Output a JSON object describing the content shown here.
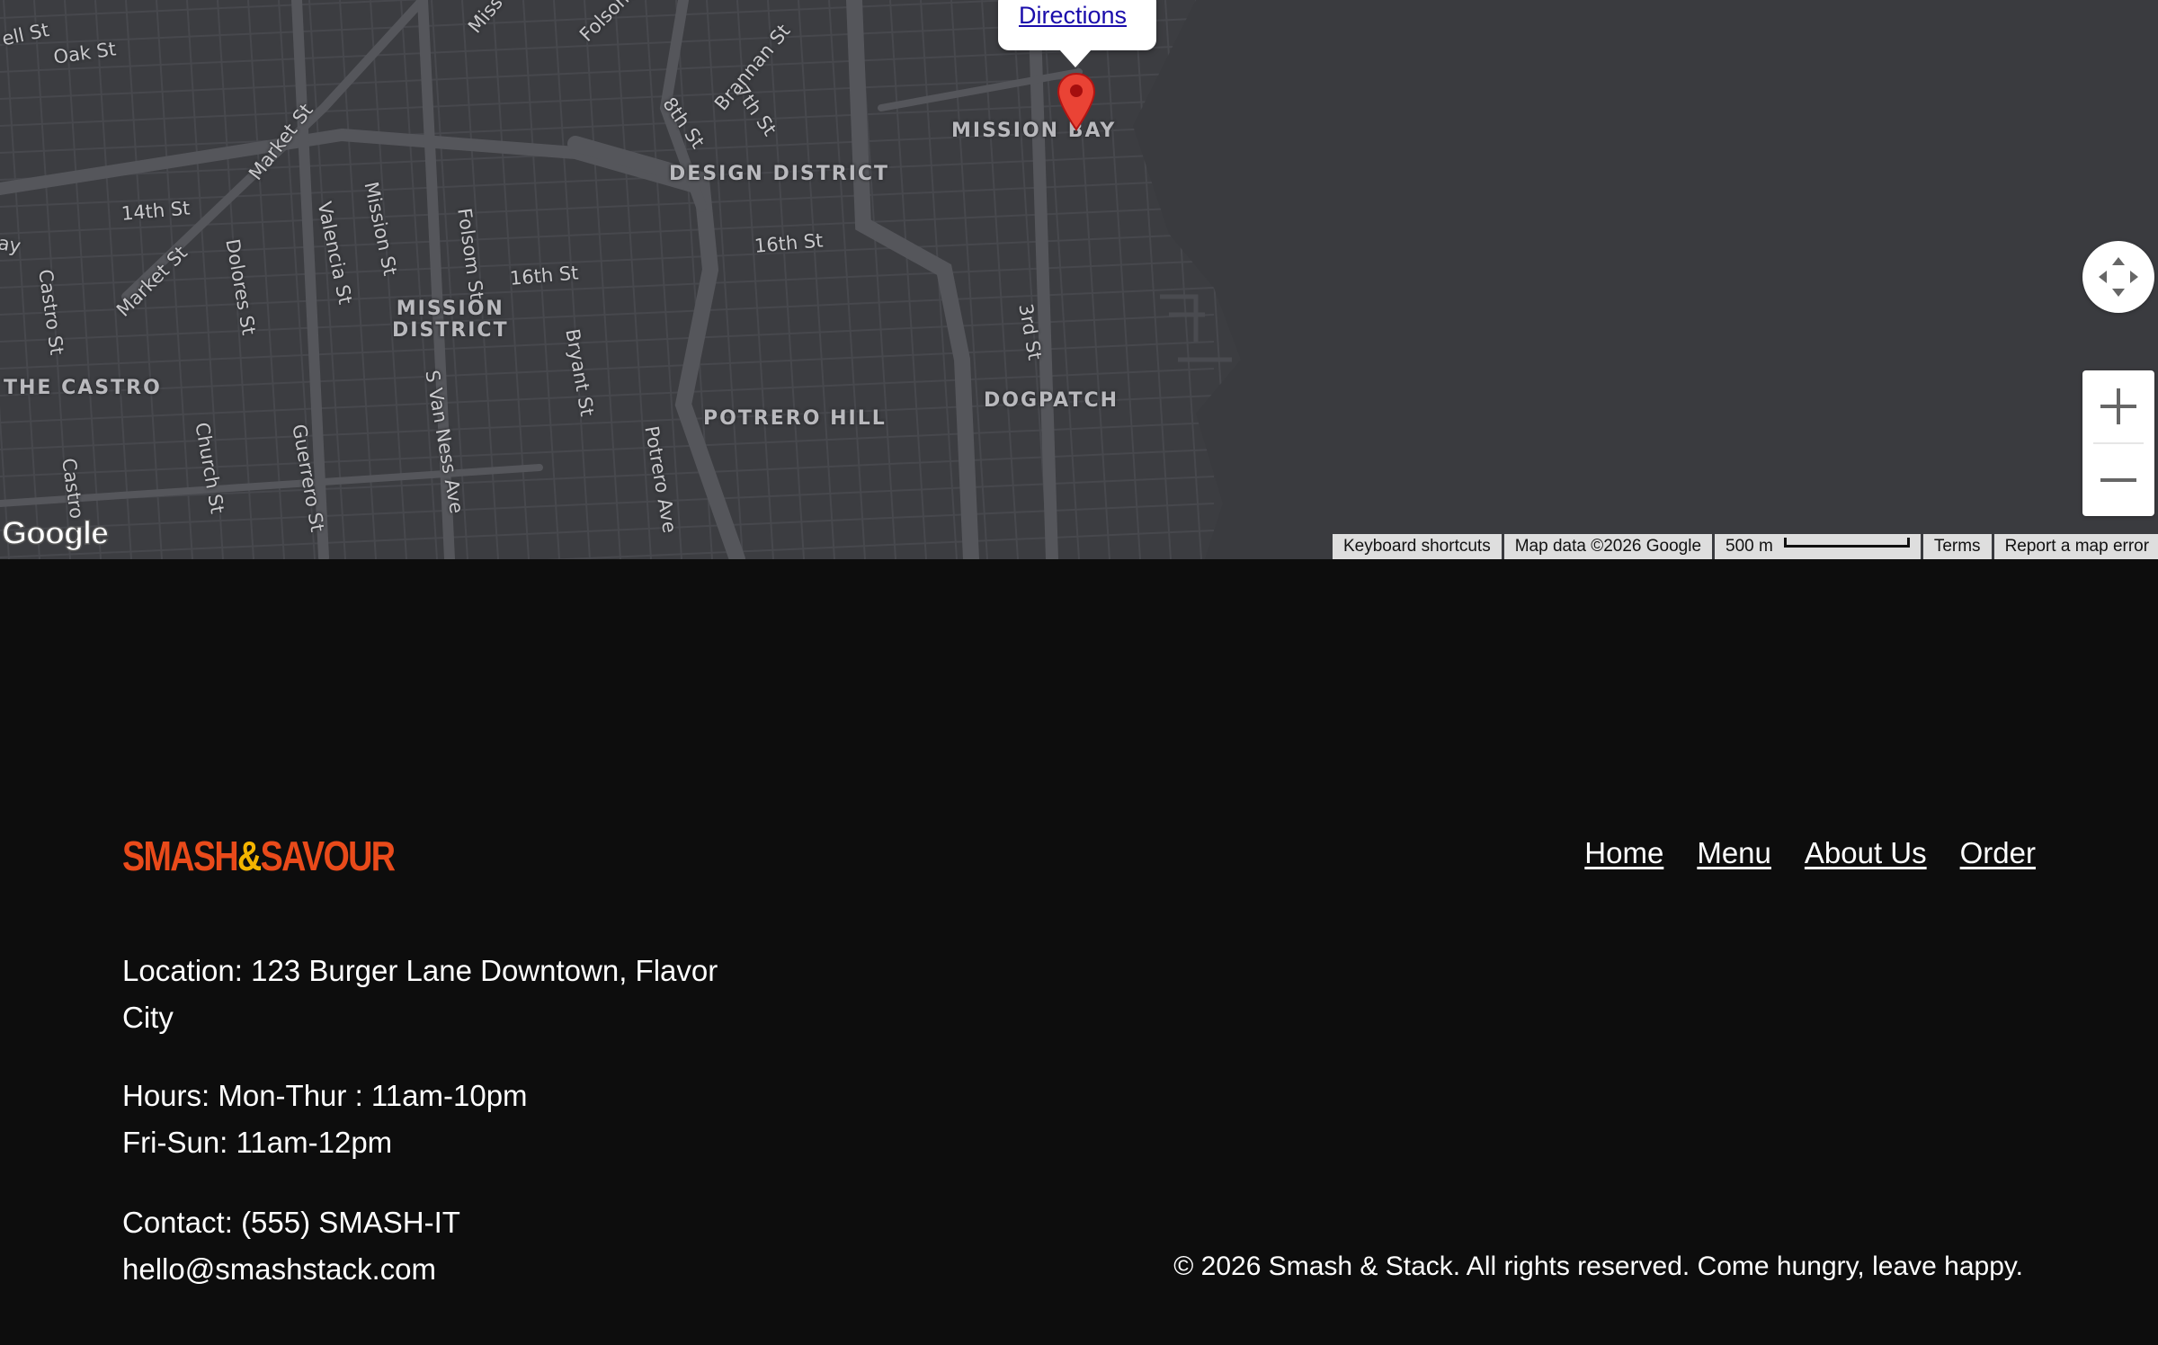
{
  "map": {
    "info_window": {
      "link_label": "Directions"
    },
    "streets": [
      "ell St",
      "Oak St",
      "Market St",
      "14th St",
      "Market St",
      "Castro St",
      "Dolores St",
      "Valencia St",
      "Mission St",
      "Folsom St",
      "16th St",
      "16th St",
      "Bryant St",
      "S Van Ness Ave",
      "Guerrero St",
      "Church St",
      "Castro",
      "Potrero Ave",
      "3rd St",
      "8th St",
      "7th St",
      "Brannan St",
      "Folsom",
      "Miss",
      "ay"
    ],
    "districts": [
      "MISSION BAY",
      "DESIGN DISTRICT",
      "MISSION\nDISTRICT",
      "THE CASTRO",
      "POTRERO HILL",
      "DOGPATCH"
    ],
    "google_logo": "Google",
    "attribution": {
      "keyboard_shortcuts": "Keyboard shortcuts",
      "map_data": "Map data ©2026 Google",
      "scale": "500 m",
      "terms": "Terms",
      "report": "Report a map error"
    },
    "colors": {
      "land": "#3c3d41",
      "road": "#4a4b50",
      "water": "#2f3034",
      "pin": "#ea4335"
    }
  },
  "footer": {
    "logo": {
      "part1": "SMASH",
      "amp": "&",
      "part2": "SAVOUR"
    },
    "nav": [
      "Home",
      "Menu",
      "About Us",
      "Order"
    ],
    "location": "Location: 123 Burger Lane Downtown, Flavor City",
    "hours_line1": "Hours: Mon-Thur : 11am-10pm",
    "hours_line2": "Fri-Sun: 11am-12pm",
    "contact_line1": "Contact: (555) SMASH-IT",
    "contact_line2": "hello@smashstack.com",
    "copyright": "© 2026 Smash & Stack. All rights reserved. Come hungry, leave happy."
  }
}
